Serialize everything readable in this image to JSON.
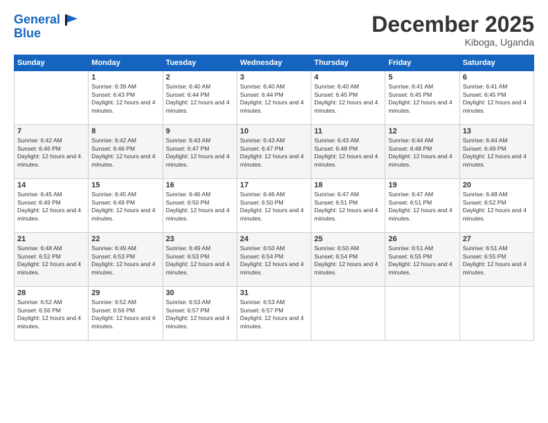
{
  "header": {
    "logo_line1": "General",
    "logo_line2": "Blue",
    "month": "December 2025",
    "location": "Kiboga, Uganda"
  },
  "days_of_week": [
    "Sunday",
    "Monday",
    "Tuesday",
    "Wednesday",
    "Thursday",
    "Friday",
    "Saturday"
  ],
  "weeks": [
    [
      {
        "day": "",
        "sunrise": "",
        "sunset": "",
        "daylight": ""
      },
      {
        "day": "1",
        "sunrise": "6:39 AM",
        "sunset": "6:43 PM",
        "daylight": "12 hours and 4 minutes."
      },
      {
        "day": "2",
        "sunrise": "6:40 AM",
        "sunset": "6:44 PM",
        "daylight": "12 hours and 4 minutes."
      },
      {
        "day": "3",
        "sunrise": "6:40 AM",
        "sunset": "6:44 PM",
        "daylight": "12 hours and 4 minutes."
      },
      {
        "day": "4",
        "sunrise": "6:40 AM",
        "sunset": "6:45 PM",
        "daylight": "12 hours and 4 minutes."
      },
      {
        "day": "5",
        "sunrise": "6:41 AM",
        "sunset": "6:45 PM",
        "daylight": "12 hours and 4 minutes."
      },
      {
        "day": "6",
        "sunrise": "6:41 AM",
        "sunset": "6:45 PM",
        "daylight": "12 hours and 4 minutes."
      }
    ],
    [
      {
        "day": "7",
        "sunrise": "6:42 AM",
        "sunset": "6:46 PM",
        "daylight": "12 hours and 4 minutes."
      },
      {
        "day": "8",
        "sunrise": "6:42 AM",
        "sunset": "6:46 PM",
        "daylight": "12 hours and 4 minutes."
      },
      {
        "day": "9",
        "sunrise": "6:43 AM",
        "sunset": "6:47 PM",
        "daylight": "12 hours and 4 minutes."
      },
      {
        "day": "10",
        "sunrise": "6:43 AM",
        "sunset": "6:47 PM",
        "daylight": "12 hours and 4 minutes."
      },
      {
        "day": "11",
        "sunrise": "6:43 AM",
        "sunset": "6:48 PM",
        "daylight": "12 hours and 4 minutes."
      },
      {
        "day": "12",
        "sunrise": "6:44 AM",
        "sunset": "6:48 PM",
        "daylight": "12 hours and 4 minutes."
      },
      {
        "day": "13",
        "sunrise": "6:44 AM",
        "sunset": "6:49 PM",
        "daylight": "12 hours and 4 minutes."
      }
    ],
    [
      {
        "day": "14",
        "sunrise": "6:45 AM",
        "sunset": "6:49 PM",
        "daylight": "12 hours and 4 minutes."
      },
      {
        "day": "15",
        "sunrise": "6:45 AM",
        "sunset": "6:49 PM",
        "daylight": "12 hours and 4 minutes."
      },
      {
        "day": "16",
        "sunrise": "6:46 AM",
        "sunset": "6:50 PM",
        "daylight": "12 hours and 4 minutes."
      },
      {
        "day": "17",
        "sunrise": "6:46 AM",
        "sunset": "6:50 PM",
        "daylight": "12 hours and 4 minutes."
      },
      {
        "day": "18",
        "sunrise": "6:47 AM",
        "sunset": "6:51 PM",
        "daylight": "12 hours and 4 minutes."
      },
      {
        "day": "19",
        "sunrise": "6:47 AM",
        "sunset": "6:51 PM",
        "daylight": "12 hours and 4 minutes."
      },
      {
        "day": "20",
        "sunrise": "6:48 AM",
        "sunset": "6:52 PM",
        "daylight": "12 hours and 4 minutes."
      }
    ],
    [
      {
        "day": "21",
        "sunrise": "6:48 AM",
        "sunset": "6:52 PM",
        "daylight": "12 hours and 4 minutes."
      },
      {
        "day": "22",
        "sunrise": "6:49 AM",
        "sunset": "6:53 PM",
        "daylight": "12 hours and 4 minutes."
      },
      {
        "day": "23",
        "sunrise": "6:49 AM",
        "sunset": "6:53 PM",
        "daylight": "12 hours and 4 minutes."
      },
      {
        "day": "24",
        "sunrise": "6:50 AM",
        "sunset": "6:54 PM",
        "daylight": "12 hours and 4 minutes."
      },
      {
        "day": "25",
        "sunrise": "6:50 AM",
        "sunset": "6:54 PM",
        "daylight": "12 hours and 4 minutes."
      },
      {
        "day": "26",
        "sunrise": "6:51 AM",
        "sunset": "6:55 PM",
        "daylight": "12 hours and 4 minutes."
      },
      {
        "day": "27",
        "sunrise": "6:51 AM",
        "sunset": "6:55 PM",
        "daylight": "12 hours and 4 minutes."
      }
    ],
    [
      {
        "day": "28",
        "sunrise": "6:52 AM",
        "sunset": "6:56 PM",
        "daylight": "12 hours and 4 minutes."
      },
      {
        "day": "29",
        "sunrise": "6:52 AM",
        "sunset": "6:56 PM",
        "daylight": "12 hours and 4 minutes."
      },
      {
        "day": "30",
        "sunrise": "6:53 AM",
        "sunset": "6:57 PM",
        "daylight": "12 hours and 4 minutes."
      },
      {
        "day": "31",
        "sunrise": "6:53 AM",
        "sunset": "6:57 PM",
        "daylight": "12 hours and 4 minutes."
      },
      {
        "day": "",
        "sunrise": "",
        "sunset": "",
        "daylight": ""
      },
      {
        "day": "",
        "sunrise": "",
        "sunset": "",
        "daylight": ""
      },
      {
        "day": "",
        "sunrise": "",
        "sunset": "",
        "daylight": ""
      }
    ]
  ],
  "labels": {
    "sunrise": "Sunrise:",
    "sunset": "Sunset:",
    "daylight": "Daylight:"
  }
}
